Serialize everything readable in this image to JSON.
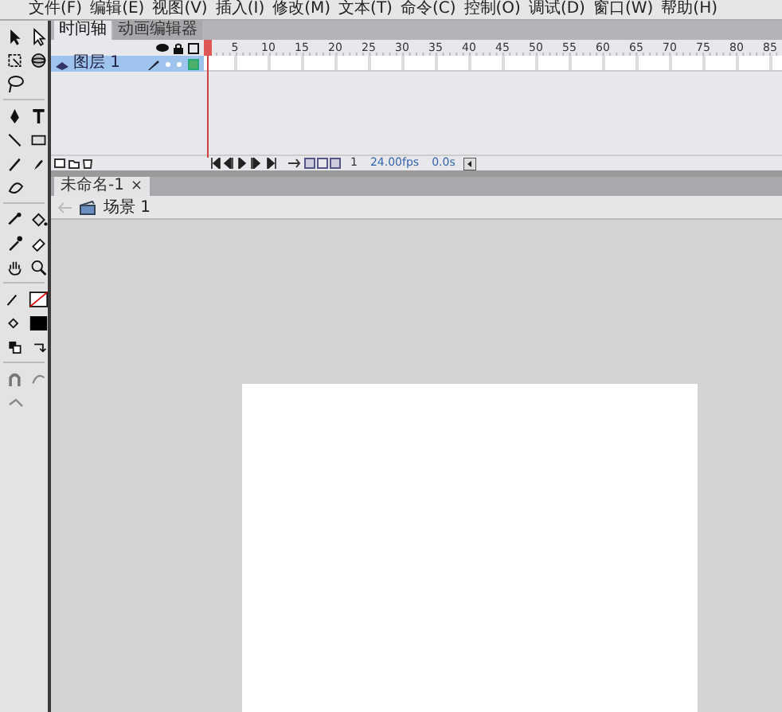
{
  "menu": [
    "文件(F)",
    "编辑(E)",
    "视图(V)",
    "插入(I)",
    "修改(M)",
    "文本(T)",
    "命令(C)",
    "控制(O)",
    "调试(D)",
    "窗口(W)",
    "帮助(H)"
  ],
  "timeline": {
    "tabs": [
      {
        "label": "时间轴",
        "selected": true
      },
      {
        "label": "动画编辑器",
        "selected": false
      }
    ],
    "frame_numbers": [
      "5",
      "10",
      "15",
      "20",
      "25",
      "30",
      "35",
      "40",
      "45",
      "50",
      "55",
      "60",
      "65",
      "70",
      "75",
      "80",
      "85"
    ],
    "layers": [
      {
        "name": "图层 1",
        "selected": true
      }
    ],
    "current_frame": "1",
    "frame_rate": "24.00fps",
    "elapsed_time": "0.0s"
  },
  "document_tabs": [
    {
      "label": "未命名-1",
      "close": "×",
      "selected": true
    }
  ],
  "scene": {
    "name": "场景 1"
  }
}
